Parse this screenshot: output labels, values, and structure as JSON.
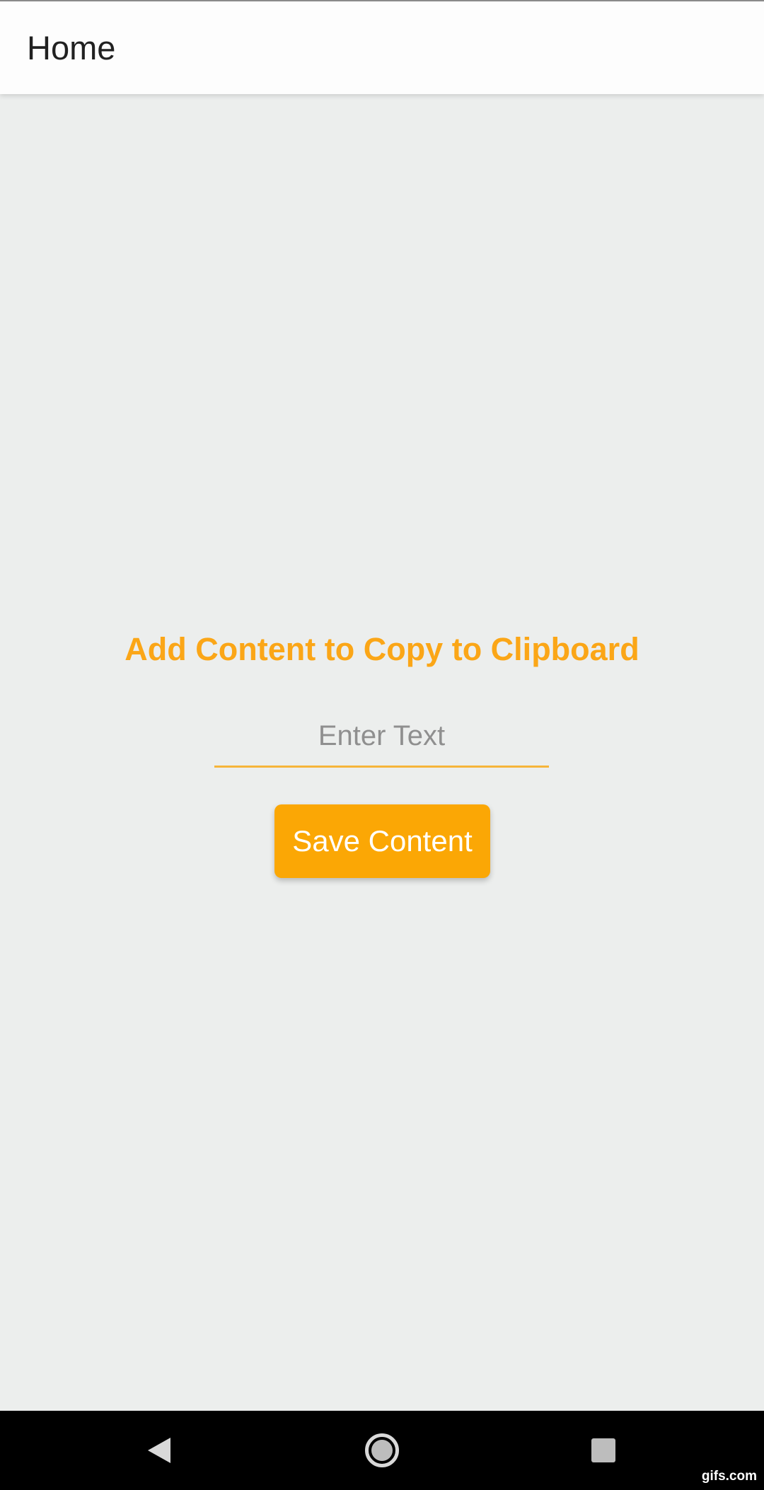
{
  "appbar": {
    "title": "Home"
  },
  "main": {
    "heading": "Add Content to Copy to Clipboard",
    "input": {
      "placeholder": "Enter Text",
      "value": ""
    },
    "save_button_label": "Save Content"
  },
  "navbar": {
    "back_icon": "back-triangle-icon",
    "home_icon": "home-circle-icon",
    "recents_icon": "recents-square-icon"
  },
  "watermark": "gifs.com",
  "colors": {
    "accent": "#fba705",
    "heading": "#fba617",
    "background": "#eceeed",
    "appbar": "#fdfdfd",
    "navbar": "#000000"
  }
}
